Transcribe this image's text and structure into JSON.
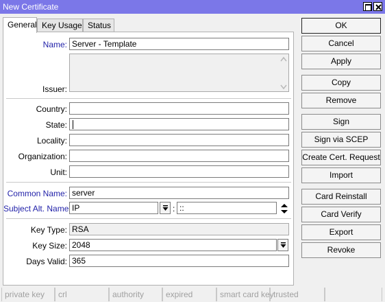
{
  "window": {
    "title": "New Certificate"
  },
  "tabs": [
    {
      "label": "General"
    },
    {
      "label": "Key Usage"
    },
    {
      "label": "Status"
    }
  ],
  "form": {
    "name": {
      "label": "Name:",
      "value": "Server - Template"
    },
    "issuer": {
      "label": "Issuer:",
      "value": ""
    },
    "country": {
      "label": "Country:",
      "value": ""
    },
    "state": {
      "label": "State:",
      "value": ""
    },
    "locality": {
      "label": "Locality:",
      "value": ""
    },
    "organization": {
      "label": "Organization:",
      "value": ""
    },
    "unit": {
      "label": "Unit:",
      "value": ""
    },
    "common_name": {
      "label": "Common Name:",
      "value": "server"
    },
    "subject_alt_name": {
      "label": "Subject Alt. Name:",
      "type": "IP",
      "separator": ":",
      "value": "::"
    },
    "key_type": {
      "label": "Key Type:",
      "value": "RSA"
    },
    "key_size": {
      "label": "Key Size:",
      "value": "2048"
    },
    "days_valid": {
      "label": "Days Valid:",
      "value": "365"
    }
  },
  "buttons": [
    {
      "label": "OK"
    },
    {
      "label": "Cancel"
    },
    {
      "label": "Apply"
    },
    {
      "label": "Copy"
    },
    {
      "label": "Remove"
    },
    {
      "label": "Sign"
    },
    {
      "label": "Sign via SCEP"
    },
    {
      "label": "Create Cert. Request"
    },
    {
      "label": "Import"
    },
    {
      "label": "Card Reinstall"
    },
    {
      "label": "Card Verify"
    },
    {
      "label": "Export"
    },
    {
      "label": "Revoke"
    }
  ],
  "status_bar": [
    {
      "label": "private key"
    },
    {
      "label": "crl"
    },
    {
      "label": "authority"
    },
    {
      "label": "expired"
    },
    {
      "label": "smart card key"
    },
    {
      "label": "trusted"
    },
    {
      "label": ""
    }
  ],
  "colors": {
    "title_bar": "#7b77e8",
    "label_highlight": "#1f1fa8",
    "status_text_disabled": "#a0a0a0"
  }
}
